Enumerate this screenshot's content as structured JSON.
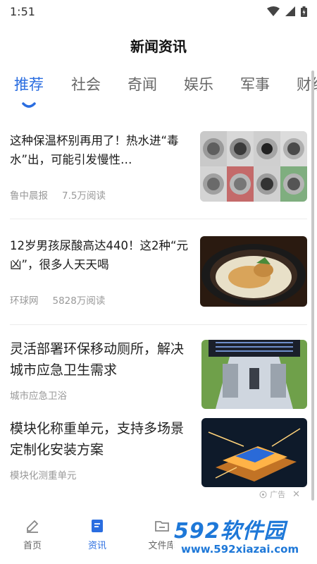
{
  "status": {
    "time": "1:51"
  },
  "header": {
    "title": "新闻资讯"
  },
  "tabs": [
    {
      "label": "推荐",
      "active": true
    },
    {
      "label": "社会",
      "active": false
    },
    {
      "label": "奇闻",
      "active": false
    },
    {
      "label": "娱乐",
      "active": false
    },
    {
      "label": "军事",
      "active": false
    },
    {
      "label": "财经",
      "active": false
    }
  ],
  "articles": [
    {
      "title": "这种保温杯别再用了！热水进“毒水”出，可能引发慢性…",
      "source": "鲁中晨报",
      "reads": "7.5万阅读"
    },
    {
      "title": "12岁男孩尿酸高达440！这2种“元凶”，很多人天天喝",
      "source": "环球网",
      "reads": "5828万阅读"
    }
  ],
  "ads": [
    {
      "title": "灵活部署环保移动厕所，解决城市应急卫生需求",
      "source": "城市应急卫浴"
    },
    {
      "title": "模块化称重单元，支持多场景定制化安装方案",
      "source": "模块化测重单元",
      "badge": "广告"
    }
  ],
  "bottom_nav": [
    {
      "label": "首页",
      "icon": "pencil-icon",
      "active": false
    },
    {
      "label": "资讯",
      "icon": "news-icon",
      "active": true
    },
    {
      "label": "文件库",
      "icon": "folder-icon",
      "active": false
    }
  ],
  "watermark": {
    "main": "592软件园",
    "sub": "www.592xiazai.com"
  },
  "colors": {
    "accent": "#2a6de0",
    "watermark": "#1e78d8"
  }
}
